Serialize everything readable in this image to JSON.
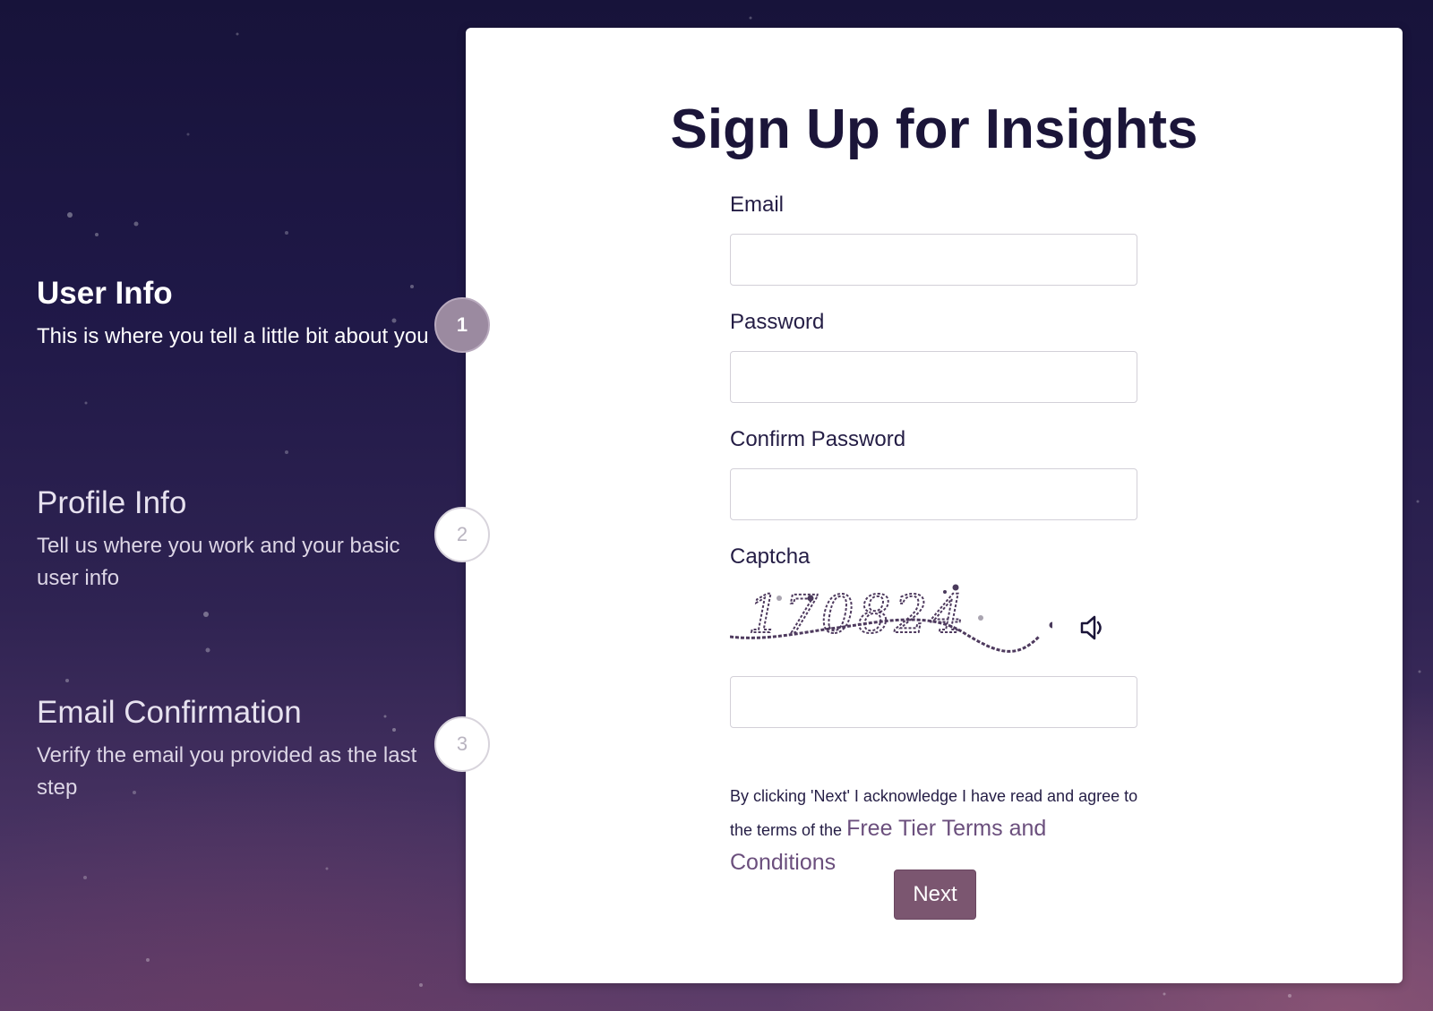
{
  "steps": [
    {
      "number": "1",
      "title": "User Info",
      "description": "This is where you tell a little bit about you",
      "state": "active"
    },
    {
      "number": "2",
      "title": "Profile Info",
      "description": "Tell us where you work and your basic user info",
      "state": "inactive"
    },
    {
      "number": "3",
      "title": "Email Confirmation",
      "description": "Verify the email you provided as the last step",
      "state": "inactive"
    }
  ],
  "form": {
    "title": "Sign Up for Insights",
    "email_label": "Email",
    "email_value": "",
    "password_label": "Password",
    "password_value": "",
    "confirm_password_label": "Confirm Password",
    "confirm_password_value": "",
    "captcha_label": "Captcha",
    "captcha_code": "170824",
    "captcha_value": "",
    "captcha_audio_icon": "speaker-icon",
    "terms_text": "By clicking 'Next' I acknowledge I have read and agree to the terms of the ",
    "terms_link": "Free Tier Terms and Conditions",
    "next_label": "Next"
  },
  "colors": {
    "accent_button": "#7b5670",
    "title_text": "#1b1539",
    "link": "#6b4f7d",
    "active_step_circle": "#9b8aa0"
  }
}
